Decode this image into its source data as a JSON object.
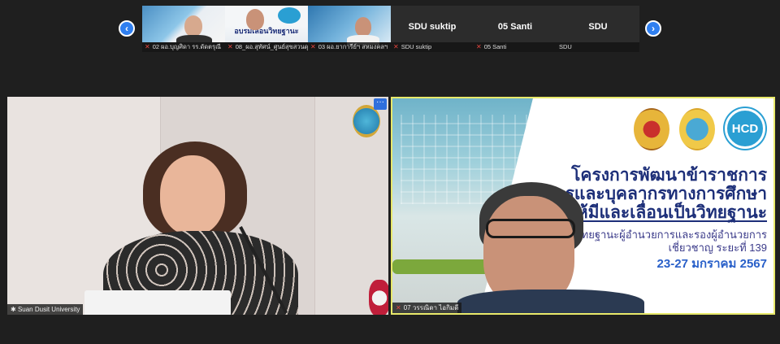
{
  "strip": {
    "prev_icon": "chevron-left-icon",
    "next_icon": "chevron-right-icon",
    "tiles": [
      {
        "caption": "02 ผอ.บุญศิดา รร.ดัดตรุณี",
        "mic_off": true,
        "center_name": ""
      },
      {
        "caption": "08_ผอ.สุทัศน์_ศูนย์สุขสวนดุสิต",
        "mic_off": true,
        "center_name": ""
      },
      {
        "caption": "03 ผอ.ยาการีย์ฯ สหมงคลฯ",
        "mic_off": true,
        "center_name": ""
      },
      {
        "caption": "SDU suktip",
        "mic_off": true,
        "center_name": "SDU suktip"
      },
      {
        "caption": "05 Santi",
        "mic_off": true,
        "center_name": "05 Santi"
      },
      {
        "caption": "SDU",
        "mic_off": false,
        "center_name": "SDU"
      }
    ]
  },
  "thumb2": {
    "banner": "อบรมเลื่อนวิทยฐานะ"
  },
  "main": {
    "left": {
      "name": "Suan Dusit University",
      "more": "···"
    },
    "right": {
      "name": "07 วรรณิดา ไอกิมดี",
      "logo_text": "HCD",
      "slide": {
        "line1": "โครงการพัฒนาข้าราชการ",
        "line2": "ครูและบุคลากรทางการศึกษา",
        "line3": "ก่อนแต่งตั้งให้มีและเลื่อนเป็นวิทยฐานะ",
        "line4": "หลักสูตรวิทยฐานะผู้อำนวยการและรองผู้อำนวยการ",
        "line5": "เชี่ยวชาญ ระยะที่ 139",
        "line6": "23-27 มกราคม 2567"
      }
    }
  },
  "colors": {
    "accent": "#2f7ff0",
    "active_border": "#e8e96a",
    "slide_text": "#1d2f79",
    "date_text": "#2960c9",
    "mic_off": "#e3453e"
  }
}
